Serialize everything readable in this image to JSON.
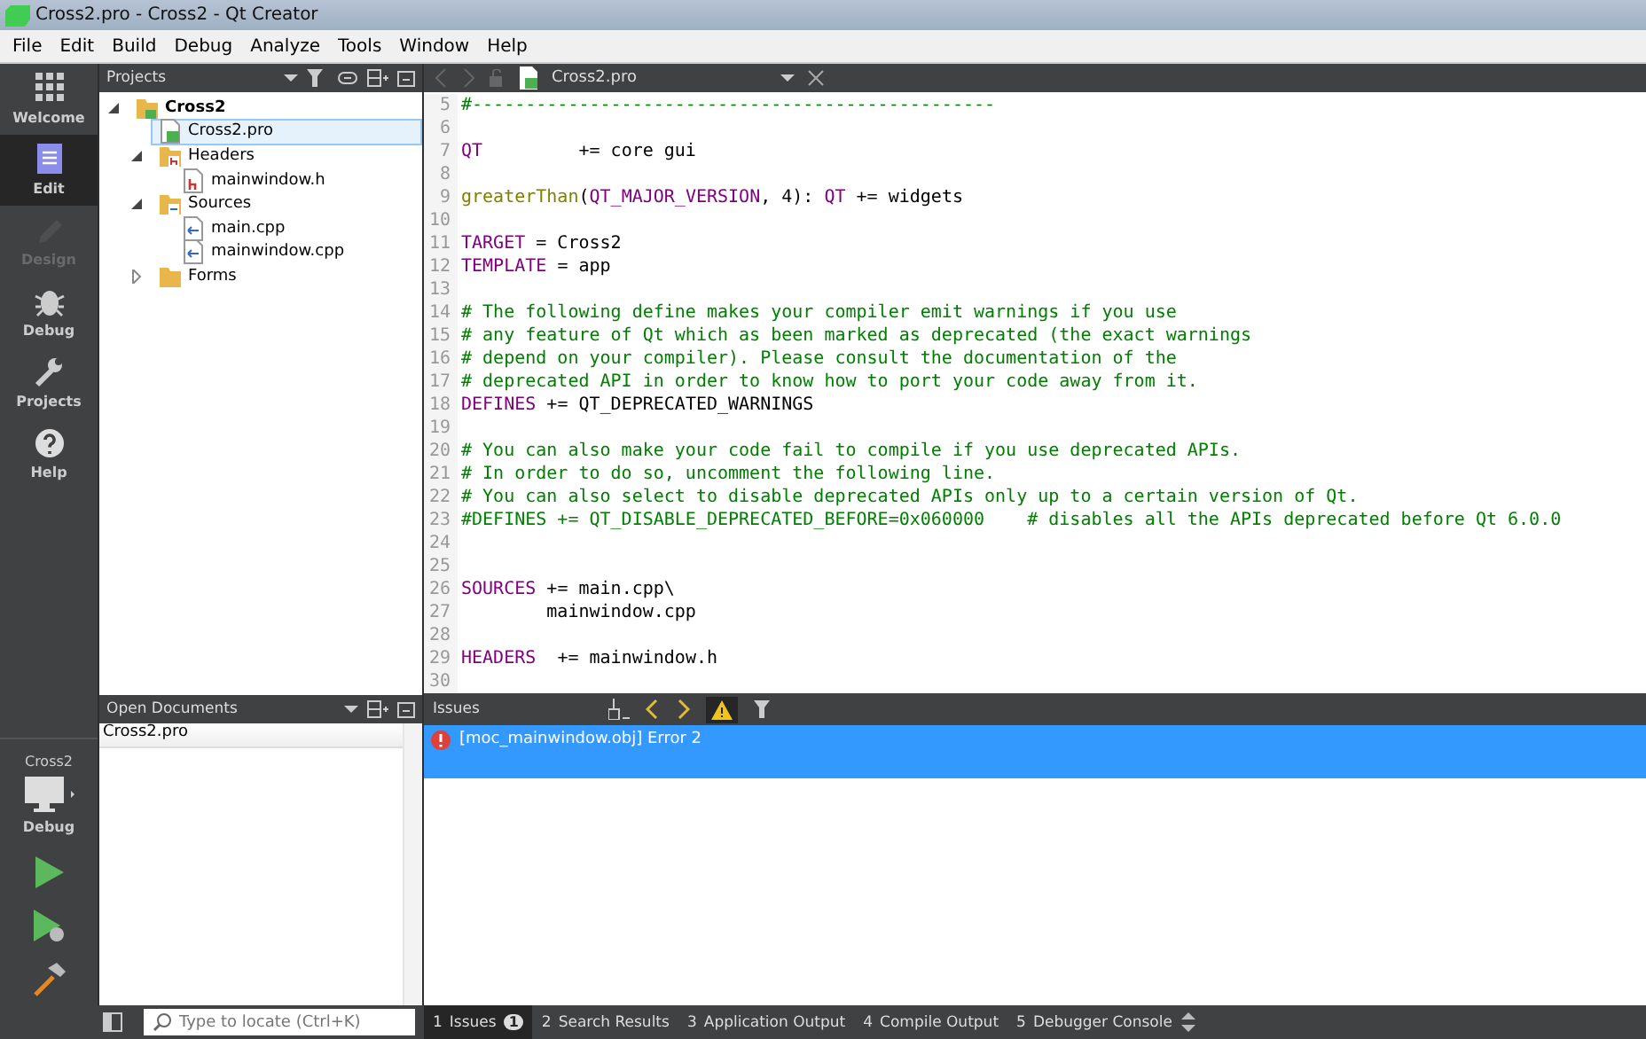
{
  "window": {
    "title": "Cross2.pro - Cross2 - Qt Creator"
  },
  "menu": [
    "File",
    "Edit",
    "Build",
    "Debug",
    "Analyze",
    "Tools",
    "Window",
    "Help"
  ],
  "modes": [
    {
      "label": "Welcome",
      "kind": "grid",
      "selected": false,
      "disabled": false
    },
    {
      "label": "Edit",
      "kind": "doc",
      "selected": true,
      "disabled": false
    },
    {
      "label": "Design",
      "kind": "pen",
      "selected": false,
      "disabled": true
    },
    {
      "label": "Debug",
      "kind": "bug",
      "selected": false,
      "disabled": false
    },
    {
      "label": "Projects",
      "kind": "wrench",
      "selected": false,
      "disabled": false
    },
    {
      "label": "Help",
      "kind": "help",
      "selected": false,
      "disabled": false
    }
  ],
  "kit": {
    "project": "Cross2",
    "config": "Debug"
  },
  "projects": {
    "title": "Projects",
    "tree": [
      {
        "label": "Cross2",
        "kind": "project",
        "bold": true,
        "expanded": true,
        "selected": false,
        "children": [
          {
            "label": "Cross2.pro",
            "kind": "pro",
            "selected": true
          },
          {
            "label": "Headers",
            "kind": "folder-h",
            "expanded": true,
            "selected": false,
            "children": [
              {
                "label": "mainwindow.h",
                "kind": "h",
                "selected": false
              }
            ]
          },
          {
            "label": "Sources",
            "kind": "folder-cpp",
            "expanded": true,
            "selected": false,
            "children": [
              {
                "label": "main.cpp",
                "kind": "cpp",
                "selected": false
              },
              {
                "label": "mainwindow.cpp",
                "kind": "cpp",
                "selected": false
              }
            ]
          },
          {
            "label": "Forms",
            "kind": "folder",
            "expanded": false,
            "selected": false
          }
        ]
      }
    ]
  },
  "open_documents": {
    "title": "Open Documents",
    "items": [
      {
        "label": "Cross2.pro",
        "selected": true
      }
    ]
  },
  "editor": {
    "file": "Cross2.pro",
    "lines": [
      {
        "num": "5",
        "segs": [
          {
            "kind": "comment",
            "text": "#-------------------------------------------------"
          }
        ]
      },
      {
        "num": "6"
      },
      {
        "num": "7",
        "segs": [
          {
            "kind": "keyword",
            "text": "QT"
          },
          {
            "kind": "plain",
            "text": "         += core gui"
          }
        ]
      },
      {
        "num": "8"
      },
      {
        "num": "9",
        "segs": [
          {
            "kind": "function",
            "text": "greaterThan"
          },
          {
            "kind": "plain",
            "text": "("
          },
          {
            "kind": "keyword",
            "text": "QT_MAJOR_VERSION"
          },
          {
            "kind": "plain",
            "text": ", 4): "
          },
          {
            "kind": "keyword",
            "text": "QT"
          },
          {
            "kind": "plain",
            "text": " += widgets"
          }
        ]
      },
      {
        "num": "10"
      },
      {
        "num": "11",
        "segs": [
          {
            "kind": "keyword",
            "text": "TARGET"
          },
          {
            "kind": "plain",
            "text": " = Cross2"
          }
        ]
      },
      {
        "num": "12",
        "segs": [
          {
            "kind": "keyword",
            "text": "TEMPLATE"
          },
          {
            "kind": "plain",
            "text": " = app"
          }
        ]
      },
      {
        "num": "13"
      },
      {
        "num": "14",
        "segs": [
          {
            "kind": "comment",
            "text": "# The following define makes your compiler emit warnings if you use"
          }
        ]
      },
      {
        "num": "15",
        "segs": [
          {
            "kind": "comment",
            "text": "# any feature of Qt which as been marked as deprecated (the exact warnings"
          }
        ]
      },
      {
        "num": "16",
        "segs": [
          {
            "kind": "comment",
            "text": "# depend on your compiler). Please consult the documentation of the"
          }
        ]
      },
      {
        "num": "17",
        "segs": [
          {
            "kind": "comment",
            "text": "# deprecated API in order to know how to port your code away from it."
          }
        ]
      },
      {
        "num": "18",
        "segs": [
          {
            "kind": "keyword",
            "text": "DEFINES"
          },
          {
            "kind": "plain",
            "text": " += QT_DEPRECATED_WARNINGS"
          }
        ]
      },
      {
        "num": "19"
      },
      {
        "num": "20",
        "segs": [
          {
            "kind": "comment",
            "text": "# You can also make your code fail to compile if you use deprecated APIs."
          }
        ]
      },
      {
        "num": "21",
        "segs": [
          {
            "kind": "comment",
            "text": "# In order to do so, uncomment the following line."
          }
        ]
      },
      {
        "num": "22",
        "segs": [
          {
            "kind": "comment",
            "text": "# You can also select to disable deprecated APIs only up to a certain version of Qt."
          }
        ]
      },
      {
        "num": "23",
        "segs": [
          {
            "kind": "comment",
            "text": "#DEFINES += QT_DISABLE_DEPRECATED_BEFORE=0x060000    # disables all the APIs deprecated before Qt 6.0.0"
          }
        ]
      },
      {
        "num": "24"
      },
      {
        "num": "25"
      },
      {
        "num": "26",
        "segs": [
          {
            "kind": "keyword",
            "text": "SOURCES"
          },
          {
            "kind": "plain",
            "text": " += main.cpp\\"
          }
        ]
      },
      {
        "num": "27",
        "segs": [
          {
            "kind": "plain",
            "text": "        mainwindow.cpp"
          }
        ]
      },
      {
        "num": "28"
      },
      {
        "num": "29",
        "segs": [
          {
            "kind": "keyword",
            "text": "HEADERS"
          },
          {
            "kind": "plain",
            "text": "  += mainwindow.h"
          }
        ]
      },
      {
        "num": "30"
      }
    ]
  },
  "issues": {
    "title": "Issues",
    "items": [
      {
        "kind": "error",
        "text": "[moc_mainwindow.obj] Error 2",
        "selected": true
      }
    ]
  },
  "locator": {
    "placeholder": "Type to locate (Ctrl+K)"
  },
  "output_tabs": [
    {
      "num": "1",
      "label": "Issues",
      "badge": "1",
      "selected": true
    },
    {
      "num": "2",
      "label": "Search Results",
      "selected": false
    },
    {
      "num": "3",
      "label": "Application Output",
      "selected": false
    },
    {
      "num": "4",
      "label": "Compile Output",
      "selected": false
    },
    {
      "num": "5",
      "label": "Debugger Console",
      "selected": false
    }
  ]
}
